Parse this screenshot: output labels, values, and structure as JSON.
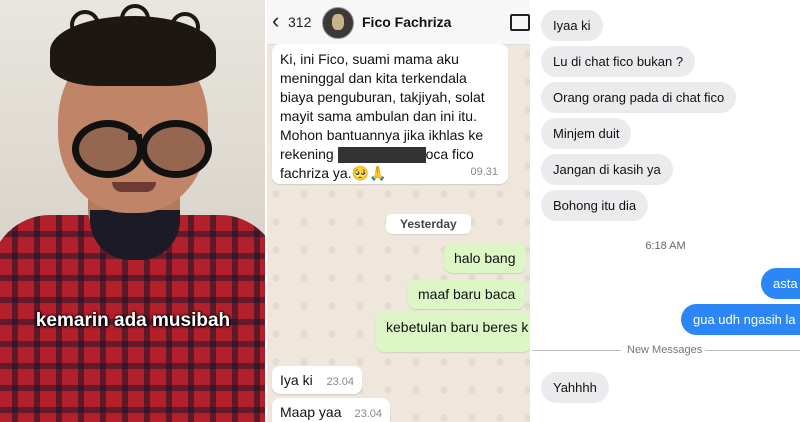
{
  "video_panel": {
    "caption": "kemarin ada musibah"
  },
  "whatsapp": {
    "back_count": "312",
    "contact_name": "Fico Fachriza",
    "message_main": {
      "lines": [
        "Ki, ini Fico, suami mama aku",
        "meninggal dan kita terkendala",
        "biaya penguburan, takjiyah, solat",
        "mayit sama ambulan dan ini itu.",
        "Mohon bantuannya jika ikhlas ke"
      ],
      "line6_prefix": "rekening",
      "line6_suffix": "oca fico",
      "line7": "fachriza ya.🥺🙏",
      "time": "09.31"
    },
    "day_divider": "Yesterday",
    "outgoing": [
      "halo bang",
      "maaf baru baca",
      "kebetulan baru beres k"
    ],
    "incoming": [
      {
        "text": "Iya ki",
        "time": "23.04"
      },
      {
        "text": "Maap yaa",
        "time": "23.04"
      }
    ]
  },
  "imessage": {
    "incoming_top": [
      "Iyaa ki",
      "Lu di chat fico bukan ?",
      "Orang orang pada di chat fico",
      "Minjem duit",
      "Jangan di kasih ya",
      "Bohong itu dia"
    ],
    "timestamp": "6:18 AM",
    "outgoing": [
      "asta",
      "gua udh ngasih la"
    ],
    "new_messages_label": "New Messages",
    "incoming_bottom": "Yahhhh",
    "colors": {
      "bubble_out": "#2d86f5",
      "bubble_in": "#ebebee"
    }
  }
}
